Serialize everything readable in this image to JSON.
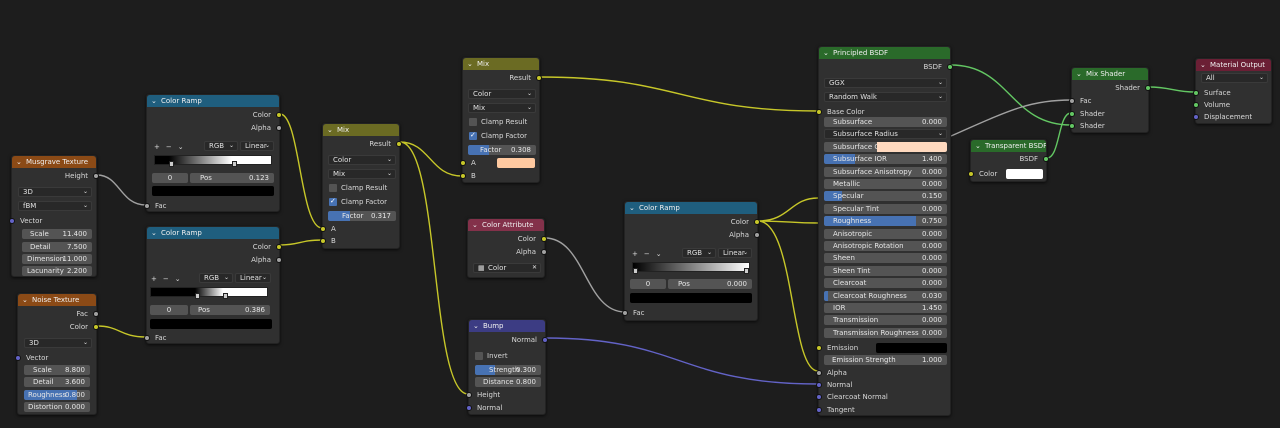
{
  "nodes": {
    "musgrave": {
      "title": "Musgrave Texture",
      "output_height": "Height",
      "dim": "3D",
      "type": "fBM",
      "input_vector": "Vector",
      "fields": [
        {
          "label": "Scale",
          "value": "11.400"
        },
        {
          "label": "Detail",
          "value": "7.500"
        },
        {
          "label": "Dimension",
          "value": "11.000"
        },
        {
          "label": "Lacunarity",
          "value": "2.200"
        }
      ]
    },
    "noise": {
      "title": "Noise Texture",
      "output_fac": "Fac",
      "output_color": "Color",
      "dim": "3D",
      "input_vector": "Vector",
      "fields": [
        {
          "label": "Scale",
          "value": "8.800"
        },
        {
          "label": "Detail",
          "value": "3.600"
        },
        {
          "label": "Roughness",
          "value": "0.800"
        },
        {
          "label": "Distortion",
          "value": "0.000"
        }
      ]
    },
    "ramp1": {
      "title": "Color Ramp",
      "out_color": "Color",
      "out_alpha": "Alpha",
      "tools": [
        "+",
        "−",
        "⌄"
      ],
      "mode": "RGB",
      "interp": "Linear",
      "index": "0",
      "pos_label": "Pos",
      "pos": "0.123",
      "in_fac": "Fac"
    },
    "ramp2": {
      "title": "Color Ramp",
      "out_color": "Color",
      "out_alpha": "Alpha",
      "tools": [
        "+",
        "−",
        "⌄"
      ],
      "mode": "RGB",
      "interp": "Linear",
      "index": "0",
      "pos_label": "Pos",
      "pos": "0.386",
      "in_fac": "Fac"
    },
    "mix1": {
      "title": "Mix",
      "out_result": "Result",
      "type": "Color",
      "blend": "Mix",
      "clamp_result": "Clamp Result",
      "clamp_result_on": false,
      "clamp_factor": "Clamp Factor",
      "clamp_factor_on": true,
      "factor_label": "Factor",
      "factor": "0.317",
      "factor_value": 0.317,
      "in_a": "A",
      "in_b": "B"
    },
    "mix2": {
      "title": "Mix",
      "out_result": "Result",
      "type": "Color",
      "blend": "Mix",
      "clamp_result": "Clamp Result",
      "clamp_result_on": false,
      "clamp_factor": "Clamp Factor",
      "clamp_factor_on": true,
      "factor_label": "Factor",
      "factor": "0.308",
      "factor_value": 0.308,
      "in_a": "A",
      "a_color": "#ffc9a0",
      "in_b": "B"
    },
    "color_attr": {
      "title": "Color Attribute",
      "out_color": "Color",
      "out_alpha": "Alpha",
      "attr_name": "Color",
      "clear": "✕"
    },
    "bump": {
      "title": "Bump",
      "out_normal": "Normal",
      "invert": "Invert",
      "strength_label": "Strength",
      "strength": "0.300",
      "strength_value": 0.3,
      "distance_label": "Distance",
      "distance": "0.800",
      "in_height": "Height",
      "in_normal": "Normal"
    },
    "ramp3": {
      "title": "Color Ramp",
      "out_color": "Color",
      "out_alpha": "Alpha",
      "tools": [
        "+",
        "−",
        "⌄"
      ],
      "mode": "RGB",
      "interp": "Linear",
      "index": "0",
      "pos_label": "Pos",
      "pos": "0.000",
      "in_fac": "Fac"
    },
    "principled": {
      "title": "Principled BSDF",
      "out_bsdf": "BSDF",
      "distribution": "GGX",
      "subsurface_method": "Random Walk",
      "base_color": "Base Color",
      "fields": [
        {
          "label": "Subsurface",
          "value": "0.000",
          "fill": 0
        },
        {
          "label": "Subsurface Radius",
          "value": "",
          "fill": 0,
          "dropdown": true
        },
        {
          "label": "Subsurface C...",
          "value": "",
          "fill": 0,
          "color": "#ffd9bf"
        },
        {
          "label": "Subsurface IOR",
          "value": "1.400",
          "fill": 0.25
        },
        {
          "label": "Subsurface Anisotropy",
          "value": "0.000",
          "fill": 0
        },
        {
          "label": "Metallic",
          "value": "0.000",
          "fill": 0
        },
        {
          "label": "Specular",
          "value": "0.150",
          "fill": 0.15
        },
        {
          "label": "Specular Tint",
          "value": "0.000",
          "fill": 0
        },
        {
          "label": "Roughness",
          "value": "0.750",
          "fill": 0.75
        },
        {
          "label": "Anisotropic",
          "value": "0.000",
          "fill": 0
        },
        {
          "label": "Anisotropic Rotation",
          "value": "0.000",
          "fill": 0
        },
        {
          "label": "Sheen",
          "value": "0.000",
          "fill": 0
        },
        {
          "label": "Sheen Tint",
          "value": "0.000",
          "fill": 0
        },
        {
          "label": "Clearcoat",
          "value": "0.000",
          "fill": 0
        },
        {
          "label": "Clearcoat Roughness",
          "value": "0.030",
          "fill": 0.03
        },
        {
          "label": "IOR",
          "value": "1.450",
          "fill": 0
        },
        {
          "label": "Transmission",
          "value": "0.000",
          "fill": 0
        },
        {
          "label": "Transmission Roughness",
          "value": "0.000",
          "fill": 0
        }
      ],
      "emission": "Emission",
      "emission_strength_label": "Emission Strength",
      "emission_strength": "1.000",
      "alpha": "Alpha",
      "normal": "Normal",
      "clearcoat_normal": "Clearcoat Normal",
      "tangent": "Tangent"
    },
    "transparent": {
      "title": "Transparent BSDF",
      "out_bsdf": "BSDF",
      "in_color": "Color"
    },
    "mixshader": {
      "title": "Mix Shader",
      "out_shader": "Shader",
      "in_fac": "Fac",
      "in_shader1": "Shader",
      "in_shader2": "Shader"
    },
    "output": {
      "title": "Material Output",
      "target": "All",
      "surface": "Surface",
      "volume": "Volume",
      "displacement": "Displacement"
    }
  },
  "colors": {
    "background": "#1d1d1d",
    "node_body": "#303030",
    "texture_header": "#8b4a16",
    "converter_header": "#1f5e7e",
    "color_header": "#6b6b23",
    "vector_header": "#3c3c83",
    "attribute_header": "#83314a",
    "shader_header": "#2a6a2a",
    "output_header": "#6b1f35",
    "slider_fill": "#4772b3",
    "socket_color": "#c7c729",
    "socket_float": "#a1a1a1",
    "socket_vector": "#6363c7",
    "socket_shader": "#63c763"
  }
}
